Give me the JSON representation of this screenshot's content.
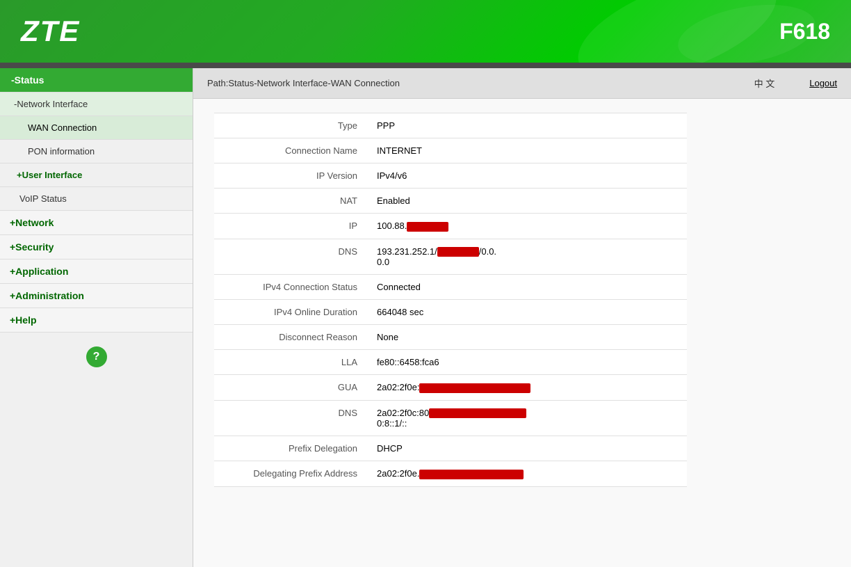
{
  "header": {
    "logo": "ZTE",
    "model": "F618"
  },
  "breadcrumb": {
    "path": "Path:Status-Network Interface-WAN Connection",
    "lang": "中 文",
    "logout": "Logout"
  },
  "sidebar": {
    "items": [
      {
        "id": "status",
        "label": "-Status",
        "type": "active-section",
        "indent": 0
      },
      {
        "id": "network-interface",
        "label": "-Network Interface",
        "type": "sub-item",
        "indent": 1
      },
      {
        "id": "wan-connection",
        "label": "WAN Connection",
        "type": "sub-sub-item",
        "indent": 2
      },
      {
        "id": "pon-information",
        "label": "PON information",
        "type": "sub-sub-item-plain",
        "indent": 2
      },
      {
        "id": "user-interface",
        "label": "+User Interface",
        "type": "section-plus",
        "indent": 1
      },
      {
        "id": "voip-status",
        "label": "VoIP Status",
        "type": "plain-sub",
        "indent": 1
      },
      {
        "id": "network",
        "label": "+Network",
        "type": "section-plus-main",
        "indent": 0
      },
      {
        "id": "security",
        "label": "+Security",
        "type": "section-plus-main",
        "indent": 0
      },
      {
        "id": "application",
        "label": "+Application",
        "type": "section-plus-main",
        "indent": 0
      },
      {
        "id": "administration",
        "label": "+Administration",
        "type": "section-plus-main",
        "indent": 0
      },
      {
        "id": "help",
        "label": "+Help",
        "type": "section-plus-main",
        "indent": 0
      }
    ],
    "help_icon": "?"
  },
  "table": {
    "rows": [
      {
        "label": "Type",
        "value": "PPP",
        "redacted": false
      },
      {
        "label": "Connection Name",
        "value": "INTERNET",
        "redacted": false
      },
      {
        "label": "IP Version",
        "value": "IPv4/v6",
        "redacted": false
      },
      {
        "label": "NAT",
        "value": "Enabled",
        "redacted": false
      },
      {
        "label": "IP",
        "value": "100.88.",
        "redacted": true,
        "redacted_suffix": ""
      },
      {
        "label": "DNS",
        "value": "193.231.252.1/",
        "redacted": true,
        "redacted_suffix": "/0.0.0.0"
      },
      {
        "label": "IPv4 Connection Status",
        "value": "Connected",
        "redacted": false
      },
      {
        "label": "IPv4 Online Duration",
        "value": "664048 sec",
        "redacted": false
      },
      {
        "label": "Disconnect Reason",
        "value": "None",
        "redacted": false
      },
      {
        "label": "LLA",
        "value": "fe80::6458:fca6",
        "redacted": false
      },
      {
        "label": "GUA",
        "value": "2a02:2f0e:",
        "redacted": true,
        "redacted_suffix": ""
      },
      {
        "label": "DNS",
        "value": "2a02:2f0c:80",
        "redacted": true,
        "redacted_suffix": "\n0:8::1/::"
      },
      {
        "label": "Prefix Delegation",
        "value": "DHCP",
        "redacted": false
      },
      {
        "label": "Delegating Prefix Address",
        "value": "2a02:2f0e.",
        "redacted": true,
        "redacted_suffix": ""
      }
    ]
  }
}
